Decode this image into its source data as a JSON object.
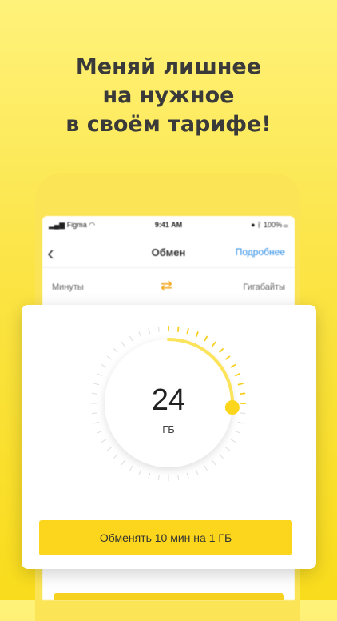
{
  "headline": {
    "line1": "Меняй лишнее",
    "line2": "на нужное",
    "line3": "в своём тарифе!"
  },
  "status_bar": {
    "carrier": "Figma",
    "time": "9:41 AM",
    "battery": "100%"
  },
  "navbar": {
    "back_icon": "‹",
    "title": "Обмен",
    "link": "Подробнее"
  },
  "exchange": {
    "left_label": "Минуты",
    "right_label": "Гигабайты",
    "swap_icon": "⇄"
  },
  "dial": {
    "value": "24",
    "unit": "ГБ",
    "level": 0.26
  },
  "action": {
    "label": "Обменять 10 мин на 1 ГБ"
  },
  "colors": {
    "accent": "#f9dc1c",
    "button": "#fcd61c",
    "link": "#2f8fe6",
    "swap": "#f2a51a"
  }
}
